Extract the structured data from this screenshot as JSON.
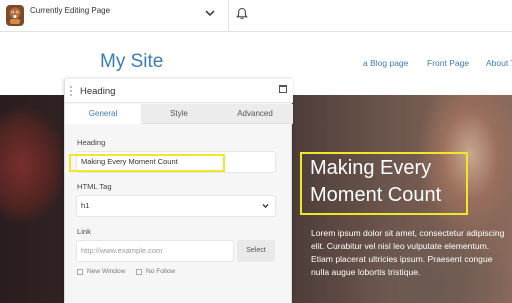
{
  "topbar": {
    "title": "Currently Editing Page",
    "icons": [
      "beaver-logo-icon",
      "chevron-down-icon",
      "bell-icon"
    ]
  },
  "site": {
    "title": "My Site",
    "nav": [
      "a Blog page",
      "Front Page",
      "About T"
    ]
  },
  "hero": {
    "heading": "Making Every Moment Count",
    "body": "Lorem ipsum dolor sit amet, consectetur adipiscing elit. Curabitur vel nisl leo vulputate elementum. Etiam placerat ultricies ipsum. Praesent congue nulla augue lobortis tristique."
  },
  "panel": {
    "title": "Heading",
    "tabs": [
      {
        "label": "General",
        "active": true
      },
      {
        "label": "Style",
        "active": false
      },
      {
        "label": "Advanced",
        "active": false
      }
    ],
    "heading_label": "Heading",
    "heading_value": "Making Every Moment Count",
    "tag_label": "HTML Tag",
    "tag_value": "h1",
    "link_label": "Link",
    "link_placeholder": "http://www.example.com",
    "select_label": "Select",
    "new_window_label": "New Window",
    "no_follow_label": "No Follow"
  },
  "colors": {
    "accent": "#3a7dbf",
    "highlight": "#f0e62a"
  }
}
